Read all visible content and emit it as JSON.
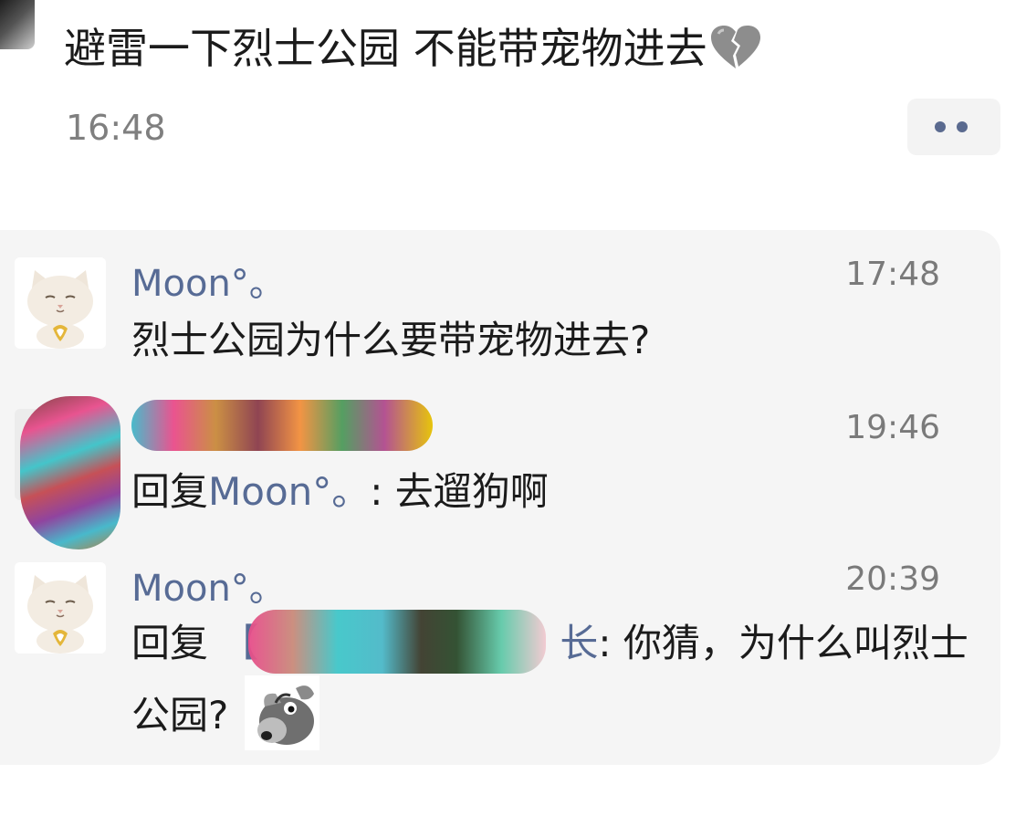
{
  "post": {
    "text": "避雷一下烈士公园 不能带宠物进去",
    "emoji": "broken-heart-icon",
    "time": "16:48"
  },
  "more_button_icon": "more-dots-icon",
  "comments": [
    {
      "author": "Moon°。",
      "time": "17:48",
      "text": "烈士公园为什么要带宠物进去?"
    },
    {
      "author": "",
      "time": "19:46",
      "reply_prefix": "回复",
      "reply_to": "Moon°。",
      "text": ": 去遛狗啊"
    },
    {
      "author": "Moon°。",
      "time": "20:39",
      "reply_prefix": "回复",
      "reply_to": "【",
      "reply_to_tail": "长",
      "text": ": 你猜，为什么叫烈士",
      "text_line2": "公园?",
      "sticker": "thinking-rat-sticker"
    }
  ],
  "colors": {
    "link": "#576b95",
    "time": "#7f7f7f",
    "comment_bg": "#f5f5f5"
  }
}
